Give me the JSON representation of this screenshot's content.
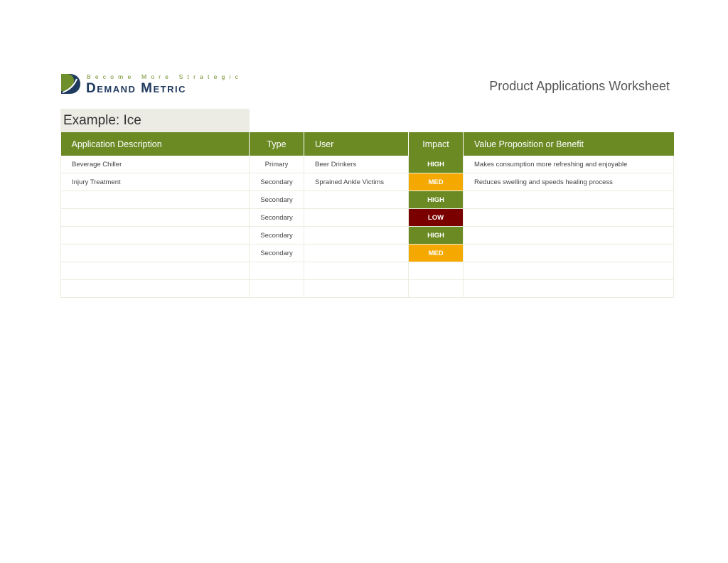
{
  "logo": {
    "tagline": "Become More Strategic",
    "name": "Demand Metric"
  },
  "title": "Product Applications Worksheet",
  "example_label": "Example: Ice",
  "colors": {
    "header_green": "#6b8a24",
    "high": "#6b8a24",
    "med": "#f5a900",
    "low": "#7a0000",
    "example_bg": "#ecebe4"
  },
  "table": {
    "headers": {
      "description": "Application Description",
      "type": "Type",
      "user": "User",
      "impact": "Impact",
      "value": "Value Proposition or Benefit"
    },
    "rows": [
      {
        "description": "Beverage Chiller",
        "type": "Primary",
        "user": "Beer Drinkers",
        "impact": "HIGH",
        "value": "Makes consumption more refreshing and enjoyable"
      },
      {
        "description": "Injury Treatment",
        "type": "Secondary",
        "user": "Sprained Ankle Victims",
        "impact": "MED",
        "value": "Reduces swelling and speeds healing process"
      },
      {
        "description": "",
        "type": "Secondary",
        "user": "",
        "impact": "HIGH",
        "value": ""
      },
      {
        "description": "",
        "type": "Secondary",
        "user": "",
        "impact": "LOW",
        "value": ""
      },
      {
        "description": "",
        "type": "Secondary",
        "user": "",
        "impact": "HIGH",
        "value": ""
      },
      {
        "description": "",
        "type": "Secondary",
        "user": "",
        "impact": "MED",
        "value": ""
      },
      {
        "description": "",
        "type": "",
        "user": "",
        "impact": "",
        "value": ""
      },
      {
        "description": "",
        "type": "",
        "user": "",
        "impact": "",
        "value": ""
      }
    ]
  }
}
